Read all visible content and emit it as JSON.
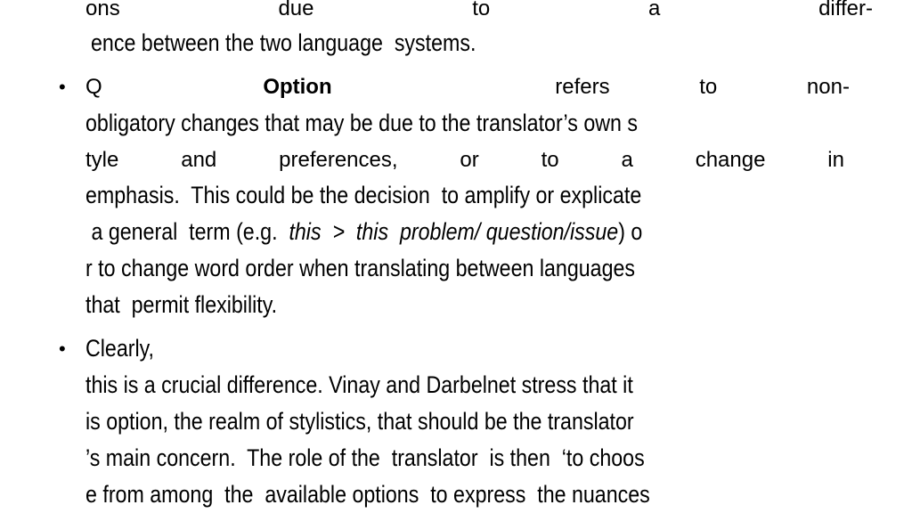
{
  "slide": {
    "paragraph_prev": {
      "line1_words": [
        "ons",
        "due",
        "to",
        "a",
        "differ-"
      ],
      "line2": "ence between the two language  systems."
    },
    "bullet_option": {
      "bullet": "•",
      "line1_words": [
        "Q",
        "Option",
        "refers",
        "to",
        "non-"
      ],
      "line1_bold_term": "Option",
      "line2": "obligatory changes that may be due to the translator’s own s",
      "line3_words": [
        "tyle",
        "and",
        "preferences,",
        "or",
        "to",
        "a",
        "change",
        "in"
      ],
      "line4": "emphasis.  This could be the decision  to amplify or explicate",
      "line5_pre": " a general  term (e.g.  ",
      "line5_italic": "this  >  this  problem/ question/issue",
      "line5_post": ") o",
      "line6": "r to change word order when translating between languages",
      "line7": "that  permit flexibility."
    },
    "bullet_clearly": {
      "bullet": "•",
      "line1": "Clearly,",
      "line2": "this is a crucial difference. Vinay and Darbelnet stress that it",
      "line3": "is option, the realm of stylistics, that should be the translator",
      "line4": "’s main concern.  The role of the  translator  is then  ‘to choos",
      "line5": "e from among  the  available options  to express  the nuances"
    }
  }
}
